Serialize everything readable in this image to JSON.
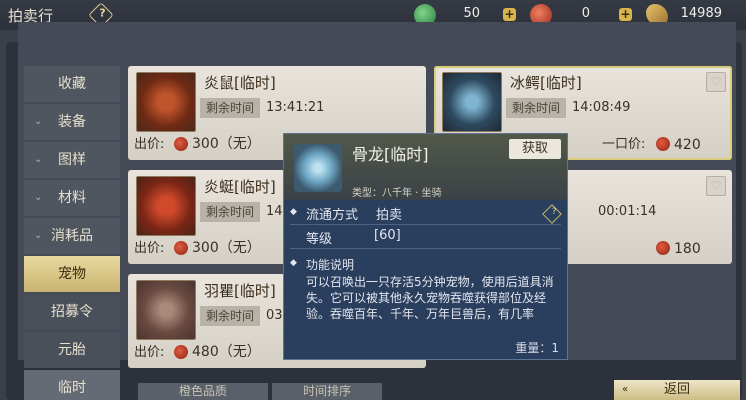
{
  "header": {
    "title": "拍卖行",
    "help_icon": "?",
    "currencies": [
      {
        "icon": "jade-currency-icon",
        "value": "50"
      },
      {
        "icon": "red-coin-icon",
        "value": "0"
      },
      {
        "icon": "gold-currency-icon",
        "value": "14989"
      }
    ]
  },
  "sidebar": {
    "items": [
      {
        "label": "收藏",
        "chevron": ""
      },
      {
        "label": "装备",
        "chevron": "⌄"
      },
      {
        "label": "图样",
        "chevron": "⌄"
      },
      {
        "label": "材料",
        "chevron": "⌄"
      },
      {
        "label": "消耗品",
        "chevron": "⌄"
      },
      {
        "label": "宠物",
        "chevron": ""
      },
      {
        "label": "招募令",
        "chevron": ""
      },
      {
        "label": "元胎",
        "chevron": ""
      },
      {
        "label": "临时",
        "chevron": ""
      }
    ]
  },
  "cards": [
    {
      "name": "炎鼠[临时]",
      "remain_label": "剩余时间",
      "time": "13:41:21",
      "price_label": "出价:",
      "price": "300（无）"
    },
    {
      "name": "冰鳄[临时]",
      "remain_label": "剩余时间",
      "time": "14:08:49",
      "price_label": "一口价:",
      "price": "420"
    },
    {
      "name": "炎蜓[临时]",
      "remain_label": "剩余时间",
      "time": "14",
      "price_label": "出价:",
      "price": "300（无）"
    },
    {
      "name": "",
      "remain_label": "",
      "time": "00:01:14",
      "price_label": "",
      "price": "180"
    },
    {
      "name": "羽瞿[临时]",
      "remain_label": "剩余时间",
      "time": "03",
      "price_label": "出价:",
      "price": "480（无）"
    }
  ],
  "tooltip": {
    "name": "骨龙[临时]",
    "type": "类型：八千年 · 坐骑",
    "acquire_button": "获取",
    "flow_label": "流通方式",
    "flow_value": "拍卖",
    "level_label": "等级",
    "level_value": "[60]",
    "desc_title": "功能说明",
    "desc_text": "可以召唤出一只存活5分钟宠物，使用后道具消失。它可以被其他永久宠物吞噬获得部位及经验。吞噬百年、千年、万年巨兽后，有几率",
    "weight": "重量：1",
    "bullet": "◆",
    "help_icon": "?"
  },
  "bottom": {
    "sort_quality": "橙色品质",
    "sort_time": "时间排序",
    "back": "返回",
    "back_arrow": "«"
  },
  "colors": {
    "tooltip_bg": "#2a3e5e",
    "sidebar_active": "#e0cd8c",
    "card_bg": "#e4dfd6"
  }
}
